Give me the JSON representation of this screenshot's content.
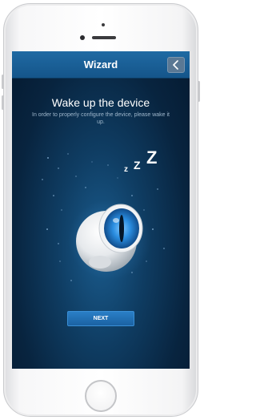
{
  "navbar": {
    "title": "Wizard"
  },
  "content": {
    "heading": "Wake up the device",
    "subtext": "In order to properly configure the device, please wake it up.",
    "sleep_text": [
      "z",
      "Z",
      "Z"
    ]
  },
  "actions": {
    "next_label": "NEXT"
  },
  "colors": {
    "navbar": "#1a5f97",
    "background": "#0a2a47",
    "button": "#2272b8",
    "eye_iris": "#2a8de0"
  },
  "icons": {
    "back": "chevron-left-icon",
    "device": "motion-sensor-eye-icon",
    "sleep": "zzz-icon"
  }
}
